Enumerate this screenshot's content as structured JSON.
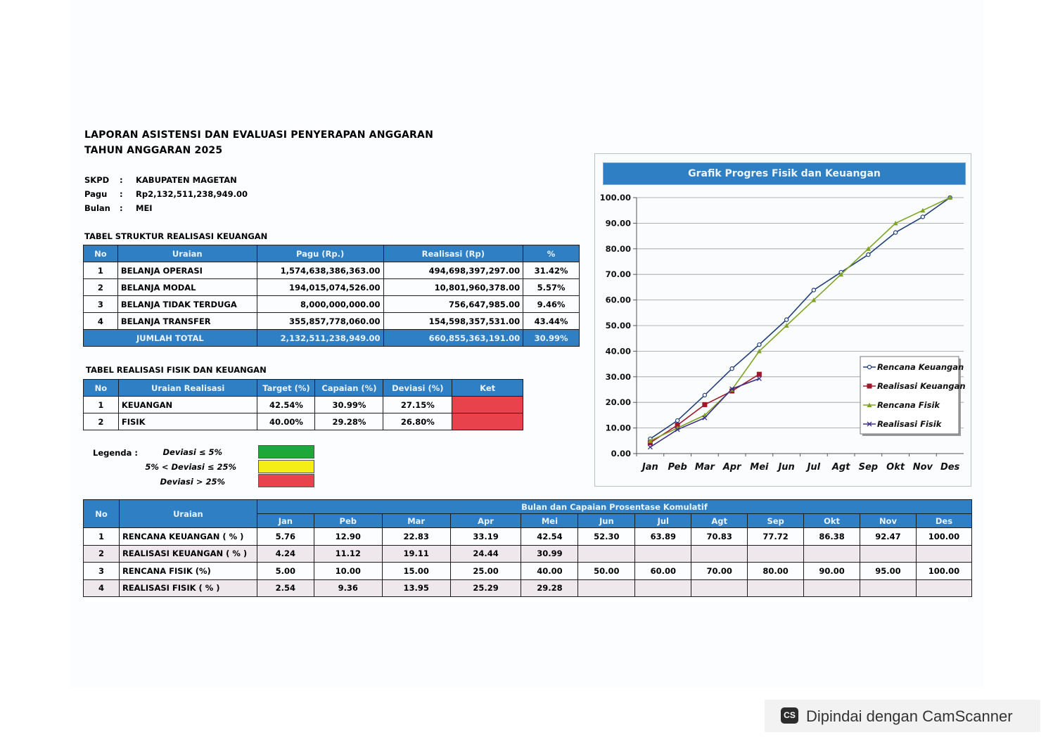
{
  "header": {
    "title_line1": "LAPORAN ASISTENSI DAN EVALUASI PENYERAPAN ANGGARAN",
    "title_line2": "TAHUN ANGGARAN 2025"
  },
  "meta": {
    "skpd_label": "SKPD",
    "skpd_value": "KABUPATEN MAGETAN",
    "pagu_label": "Pagu",
    "pagu_value": "Rp2,132,511,238,949.00",
    "bulan_label": "Bulan",
    "bulan_value": "MEI",
    "separator": ":"
  },
  "struktur": {
    "title": "TABEL STRUKTUR REALISASI KEUANGAN",
    "headers": [
      "No",
      "Uraian",
      "Pagu (Rp.)",
      "Realisasi (Rp)",
      "%"
    ],
    "rows": [
      {
        "no": "1",
        "uraian": "BELANJA OPERASI",
        "pagu": "1,574,638,386,363.00",
        "realisasi": "494,698,397,297.00",
        "pct": "31.42%"
      },
      {
        "no": "2",
        "uraian": "BELANJA MODAL",
        "pagu": "194,015,074,526.00",
        "realisasi": "10,801,960,378.00",
        "pct": "5.57%"
      },
      {
        "no": "3",
        "uraian": "BELANJA TIDAK TERDUGA",
        "pagu": "8,000,000,000.00",
        "realisasi": "756,647,985.00",
        "pct": "9.46%"
      },
      {
        "no": "4",
        "uraian": "BELANJA TRANSFER",
        "pagu": "355,857,778,060.00",
        "realisasi": "154,598,357,531.00",
        "pct": "43.44%"
      }
    ],
    "total": {
      "label": "JUMLAH TOTAL",
      "pagu": "2,132,511,238,949.00",
      "realisasi": "660,855,363,191.00",
      "pct": "30.99%"
    }
  },
  "fisik_keuangan": {
    "title": "TABEL REALISASI FISIK DAN KEUANGAN",
    "headers": [
      "No",
      "Uraian Realisasi",
      "Target (%)",
      "Capaian (%)",
      "Deviasi (%)",
      "Ket"
    ],
    "rows": [
      {
        "no": "1",
        "uraian": "KEUANGAN",
        "target": "42.54%",
        "capaian": "30.99%",
        "deviasi": "27.15%",
        "ket_color": "#e8424c"
      },
      {
        "no": "2",
        "uraian": "FISIK",
        "target": "40.00%",
        "capaian": "29.28%",
        "deviasi": "26.80%",
        "ket_color": "#e8424c"
      }
    ]
  },
  "legend": {
    "label": "Legenda :",
    "items": [
      {
        "text": "Deviasi ≤ 5%",
        "color": "#1ea83a"
      },
      {
        "text": "5% < Deviasi ≤ 25%",
        "color": "#f4ee16"
      },
      {
        "text": "Deviasi > 25%",
        "color": "#e8424c"
      }
    ]
  },
  "bulanan": {
    "header_no": "No",
    "header_uraian": "Uraian",
    "header_group": "Bulan dan Capaian Prosentase Komulatif",
    "months": [
      "Jan",
      "Peb",
      "Mar",
      "Apr",
      "Mei",
      "Jun",
      "Jul",
      "Agt",
      "Sep",
      "Okt",
      "Nov",
      "Des"
    ],
    "rows": [
      {
        "no": "1",
        "uraian": "RENCANA KEUANGAN ( % )",
        "values": [
          "5.76",
          "12.90",
          "22.83",
          "33.19",
          "42.54",
          "52.30",
          "63.89",
          "70.83",
          "77.72",
          "86.38",
          "92.47",
          "100.00"
        ]
      },
      {
        "no": "2",
        "uraian": "REALISASI KEUANGAN ( % )",
        "values": [
          "4.24",
          "11.12",
          "19.11",
          "24.44",
          "30.99",
          "",
          "",
          "",
          "",
          "",
          "",
          ""
        ]
      },
      {
        "no": "3",
        "uraian": "RENCANA FISIK (%)",
        "values": [
          "5.00",
          "10.00",
          "15.00",
          "25.00",
          "40.00",
          "50.00",
          "60.00",
          "70.00",
          "80.00",
          "90.00",
          "95.00",
          "100.00"
        ]
      },
      {
        "no": "4",
        "uraian": "REALISASI FISIK ( % )",
        "values": [
          "2.54",
          "9.36",
          "13.95",
          "25.29",
          "29.28",
          "",
          "",
          "",
          "",
          "",
          "",
          ""
        ]
      }
    ]
  },
  "chart_data": {
    "type": "line",
    "title": "Grafik Progres Fisik dan Keuangan",
    "categories": [
      "Jan",
      "Peb",
      "Mar",
      "Apr",
      "Mei",
      "Jun",
      "Jul",
      "Agt",
      "Sep",
      "Okt",
      "Nov",
      "Des"
    ],
    "ylim": [
      0,
      100
    ],
    "yticks": [
      "0.00",
      "10.00",
      "20.00",
      "30.00",
      "40.00",
      "50.00",
      "60.00",
      "70.00",
      "80.00",
      "90.00",
      "100.00"
    ],
    "grid": true,
    "legend_position": "right",
    "series": [
      {
        "name": "Rencana Keuangan",
        "color": "#1f3f7a",
        "marker": "circle",
        "values": [
          5.76,
          12.9,
          22.83,
          33.19,
          42.54,
          52.3,
          63.89,
          70.83,
          77.72,
          86.38,
          92.47,
          100.0
        ]
      },
      {
        "name": "Realisasi Keuangan",
        "color": "#a0192b",
        "marker": "square",
        "values": [
          4.24,
          11.12,
          19.11,
          24.44,
          30.99
        ]
      },
      {
        "name": "Rencana Fisik",
        "color": "#7fa325",
        "marker": "triangle",
        "values": [
          5.0,
          10.0,
          15.0,
          25.0,
          40.0,
          50.0,
          60.0,
          70.0,
          80.0,
          90.0,
          95.0,
          100.0
        ]
      },
      {
        "name": "Realisasi Fisik",
        "color": "#3b2f87",
        "marker": "x",
        "values": [
          2.54,
          9.36,
          13.95,
          25.29,
          29.28
        ]
      }
    ]
  },
  "scan_badge": {
    "icon_text": "CS",
    "text": "Dipindai dengan CamScanner"
  }
}
